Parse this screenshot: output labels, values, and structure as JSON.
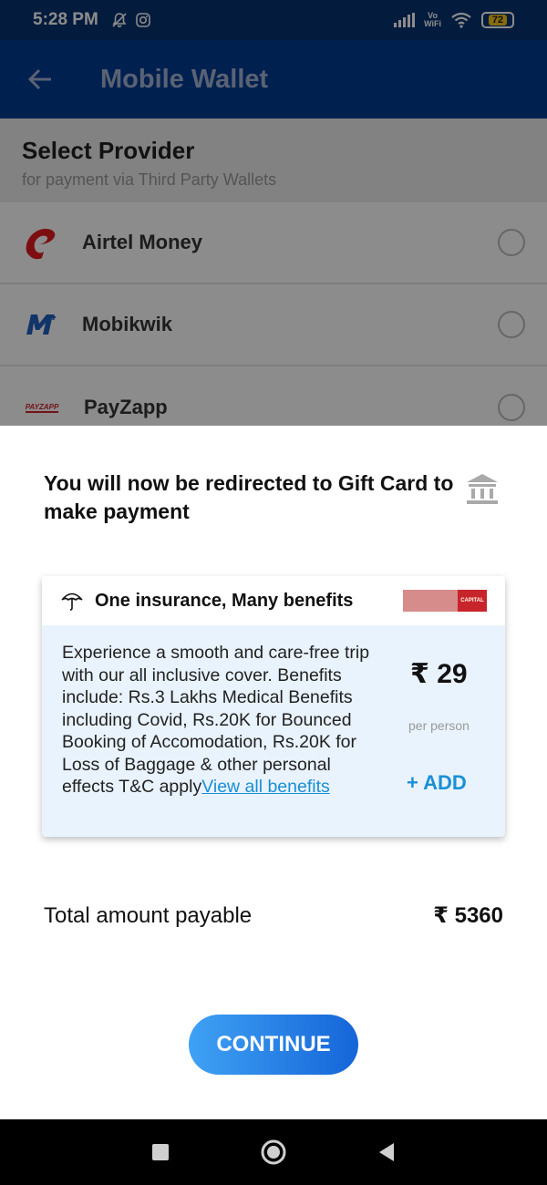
{
  "status_bar": {
    "time": "5:28 PM",
    "battery": "72",
    "network_label_top": "Vo",
    "network_label_bottom": "WiFi"
  },
  "app_bar": {
    "title": "Mobile Wallet",
    "back_icon": "arrow-left-icon"
  },
  "provider_section": {
    "title": "Select Provider",
    "subtitle": "for payment via Third Party Wallets",
    "providers": [
      {
        "name": "Airtel Money",
        "logo": "airtel-logo"
      },
      {
        "name": "Mobikwik",
        "logo": "mobikwik-logo"
      },
      {
        "name": "PayZapp",
        "logo": "payzapp-logo",
        "logo_text": "PAYZAPP"
      }
    ]
  },
  "sheet": {
    "redirect_message": "You will now be redirected to Gift Card to make payment",
    "insurance": {
      "title": "One insurance, Many benefits",
      "description": "Experience a smooth and care-free trip with our all inclusive cover. Benefits include: Rs.3 Lakhs Medical Benefits including Covid, Rs.20K for Bounced Booking of Accomodation, Rs.20K for Loss of Baggage & other personal effects T&C apply",
      "link_text": "View all benefits",
      "price": "₹ 29",
      "price_unit": "per person",
      "add_label": "+ ADD",
      "partner_logo_text": "CAPITAL"
    },
    "total_label": "Total amount payable",
    "total_value": "₹ 5360",
    "continue_label": "CONTINUE"
  },
  "colors": {
    "app_bar": "#003b92",
    "status_bar": "#06326f",
    "accent": "#1a8fd6",
    "insurance_bg": "#e9f3fd"
  }
}
